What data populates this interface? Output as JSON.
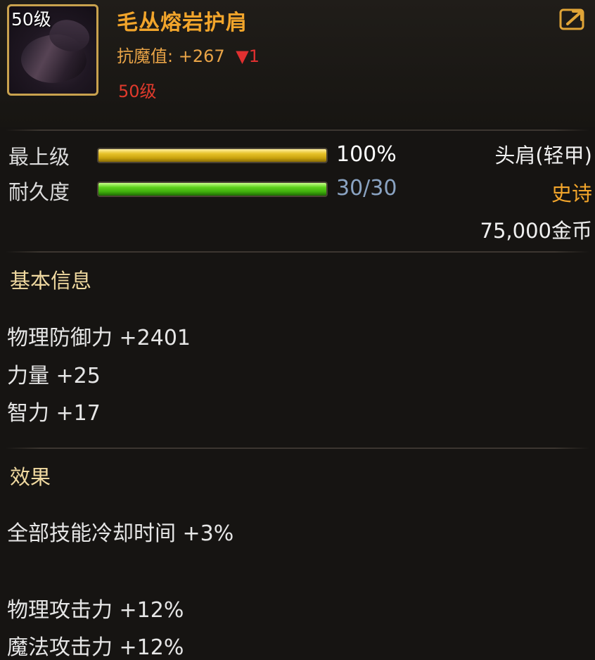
{
  "item": {
    "level_badge": "50级",
    "name": "毛丛熔岩护肩",
    "resist_label": "抗魔值:",
    "resist_value": "+267",
    "resist_delta": "▼1",
    "required_level": "50级"
  },
  "bars": {
    "grade": {
      "label": "最上级",
      "value": "100%",
      "fill_percent": 100
    },
    "durability": {
      "label": "耐久度",
      "value": "30/30",
      "current": 30,
      "max": 30
    }
  },
  "right_info": {
    "slot": "头肩(轻甲)",
    "rarity": "史诗",
    "price": "75,000金币"
  },
  "basic_info": {
    "title": "基本信息",
    "stats": [
      "物理防御力 +2401",
      "力量 +25",
      "智力 +17"
    ]
  },
  "effects": {
    "title": "效果",
    "lines": [
      "全部技能冷却时间 +3%",
      "物理攻击力 +12%",
      "魔法攻击力 +12%"
    ]
  },
  "icons": {
    "export": "export-icon",
    "item": "shoulder-armor-icon"
  },
  "colors": {
    "name": "#f2a52b",
    "rarity": "#f2a52b",
    "required_level": "#e03a2c",
    "durability_value": "#8aa3c2",
    "gold_bar": "#e7c22a",
    "green_bar": "#5dd11b"
  }
}
